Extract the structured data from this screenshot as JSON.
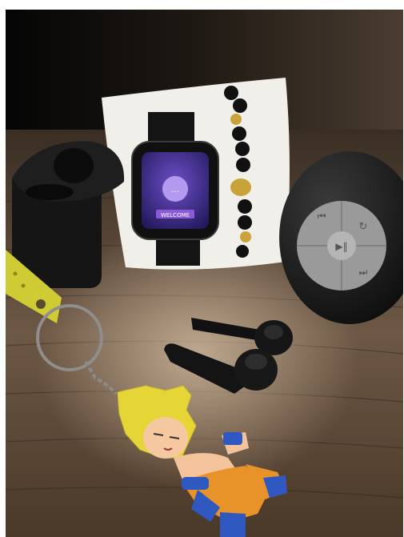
{
  "photo": {
    "subject": "product-photo-smartwatch-earbuds-speaker-keychain",
    "watch_screen_text": "WELCOME",
    "colors": {
      "wood_dark": "#3a2a1c",
      "wood_light": "#a08668",
      "watch_screen": "#3b2a86",
      "watch_banner": "#8a5ad8",
      "keychain_yellow": "#d8d43a",
      "figure_hair": "#e8d838",
      "figure_pants": "#e8922a",
      "figure_blue": "#2f58c0"
    },
    "objects": [
      "black-earbuds-case",
      "smartwatch-on-cushion",
      "beaded-bracelet",
      "bluetooth-speaker",
      "wireless-earbuds",
      "anime-figure-keychain"
    ]
  }
}
